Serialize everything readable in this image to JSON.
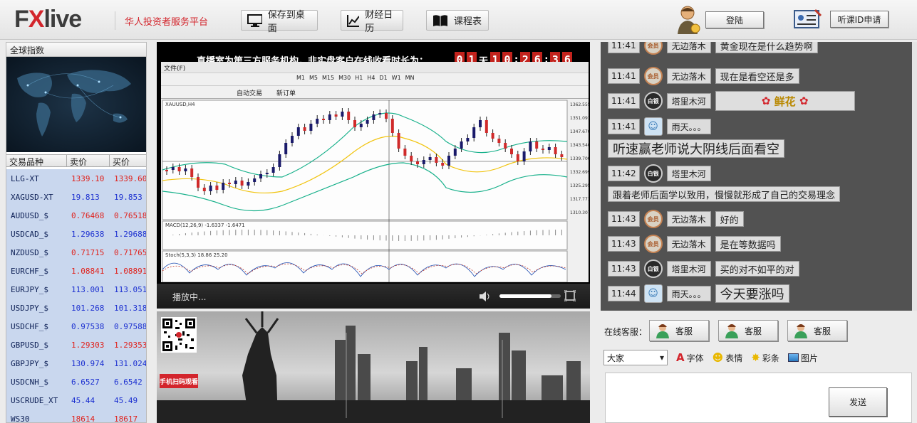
{
  "header": {
    "logo_prefix": "F",
    "logo_x": "X",
    "logo_suffix": "live",
    "slogan": "华人投资者服务平台",
    "save_desktop": "保存到桌面",
    "calendar": "财经日历",
    "schedule": "课程表",
    "login": "登陆",
    "apply": "听课ID申请"
  },
  "left_panel": {
    "title": "全球指数",
    "col_symbol": "交易品种",
    "col_sell": "卖价",
    "col_buy": "买价",
    "quotes": [
      {
        "symbol": "LLG-XT",
        "sell": "1339.10",
        "buy": "1339.60",
        "color": "red"
      },
      {
        "symbol": "XAGUSD-XT",
        "sell": "19.813",
        "buy": "19.853",
        "color": "blue"
      },
      {
        "symbol": "AUDUSD_$",
        "sell": "0.76468",
        "buy": "0.76518",
        "color": "red"
      },
      {
        "symbol": "USDCAD_$",
        "sell": "1.29638",
        "buy": "1.29688",
        "color": "blue"
      },
      {
        "symbol": "NZDUSD_$",
        "sell": "0.71715",
        "buy": "0.71765",
        "color": "red"
      },
      {
        "symbol": "EURCHF_$",
        "sell": "1.08841",
        "buy": "1.08891",
        "color": "red"
      },
      {
        "symbol": "EURJPY_$",
        "sell": "113.001",
        "buy": "113.051",
        "color": "blue"
      },
      {
        "symbol": "USDJPY_$",
        "sell": "101.268",
        "buy": "101.318",
        "color": "blue"
      },
      {
        "symbol": "USDCHF_$",
        "sell": "0.97538",
        "buy": "0.97588",
        "color": "blue"
      },
      {
        "symbol": "GBPUSD_$",
        "sell": "1.29303",
        "buy": "1.29353",
        "color": "red"
      },
      {
        "symbol": "GBPJPY_$",
        "sell": "130.974",
        "buy": "131.024",
        "color": "blue"
      },
      {
        "symbol": "USDCNH_$",
        "sell": "6.6527",
        "buy": "6.6542",
        "color": "blue"
      },
      {
        "symbol": "USCRUDE_XT",
        "sell": "45.44",
        "buy": "45.49",
        "color": "blue"
      },
      {
        "symbol": "WS30",
        "sell": "18614",
        "buy": "18617",
        "color": "red"
      }
    ]
  },
  "video": {
    "notice": "直播室为第三方服务机构，非实盘客户在线收看时长为：",
    "timer_day_digits": [
      "0",
      "1"
    ],
    "timer_day_label": "天",
    "timer_h": [
      "1",
      "0"
    ],
    "timer_m": [
      "2",
      "6"
    ],
    "timer_s": [
      "3",
      "6"
    ],
    "timer_sep": ":",
    "status": "播放中...",
    "volume_level": 0.85,
    "mt4_menu": "文件(F)",
    "mt4_symbol": "XAUUSD,H4",
    "mt4_macd": "MACD(12,26,9) -1.6337 -1.6471",
    "mt4_stoch": "Stoch(5,3,3) 18.86 25.20",
    "mt4_price_ticks": [
      "1362.555",
      "1351.091",
      "1347.670",
      "1343.540",
      "1339.700",
      "1332.699",
      "1325.295",
      "1317.771",
      "1310.307"
    ],
    "mt4_btn_auto": "自动交易",
    "mt4_btn_new": "新订单",
    "timeframes": [
      "M1",
      "M5",
      "M15",
      "M30",
      "H1",
      "H4",
      "D1",
      "W1",
      "MN"
    ]
  },
  "banner": {
    "qr_caption": "手机扫码观看"
  },
  "chat": {
    "messages": [
      {
        "time": "11:41",
        "avatar": "会员",
        "avatar_type": "vip",
        "name": "无边落木",
        "text": "黄金现在是什么趋势啊",
        "big": false
      },
      {
        "time": "11:41",
        "avatar": "会员",
        "avatar_type": "vip",
        "name": "无边落木",
        "text": "现在是看空还是多",
        "big": false
      },
      {
        "time": "11:41",
        "avatar": "白银",
        "avatar_type": "dark",
        "name": "塔里木河",
        "text": "鲜花",
        "big": false,
        "flower": true
      },
      {
        "time": "11:41",
        "avatar": "☺",
        "avatar_type": "pic",
        "name": "雨天。。。",
        "text": "",
        "big": false
      },
      {
        "time": "",
        "avatar": "",
        "avatar_type": "",
        "name": "",
        "text": "听速赢老师说大阴线后面看空",
        "big": true
      },
      {
        "time": "11:42",
        "avatar": "白银",
        "avatar_type": "dark",
        "name": "塔里木河",
        "text": "",
        "big": false
      },
      {
        "time": "",
        "avatar": "",
        "avatar_type": "",
        "name": "",
        "text": "跟着老师后面学以致用，慢慢就形成了自己的交易理念",
        "big": false
      },
      {
        "time": "11:43",
        "avatar": "会员",
        "avatar_type": "vip",
        "name": "无边落木",
        "text": "好的",
        "big": false
      },
      {
        "time": "11:43",
        "avatar": "会员",
        "avatar_type": "vip",
        "name": "无边落木",
        "text": "是在等数据吗",
        "big": false
      },
      {
        "time": "11:43",
        "avatar": "白银",
        "avatar_type": "dark",
        "name": "塔里木河",
        "text": "买的对不如平的对",
        "big": false
      },
      {
        "time": "11:44",
        "avatar": "☺",
        "avatar_type": "pic",
        "name": "雨天。。。",
        "text": "今天要涨吗",
        "big": true
      }
    ]
  },
  "support": {
    "label": "在线客服：",
    "agents": [
      "客服",
      "客服",
      "客服"
    ],
    "target": "大家",
    "font": "字体",
    "emoji": "表情",
    "ribbon": "彩条",
    "image": "图片",
    "send": "发送"
  },
  "colors": {
    "accent_red": "#d3252c",
    "quote_bg": "#c9d7ee",
    "chat_bg": "#525252"
  }
}
